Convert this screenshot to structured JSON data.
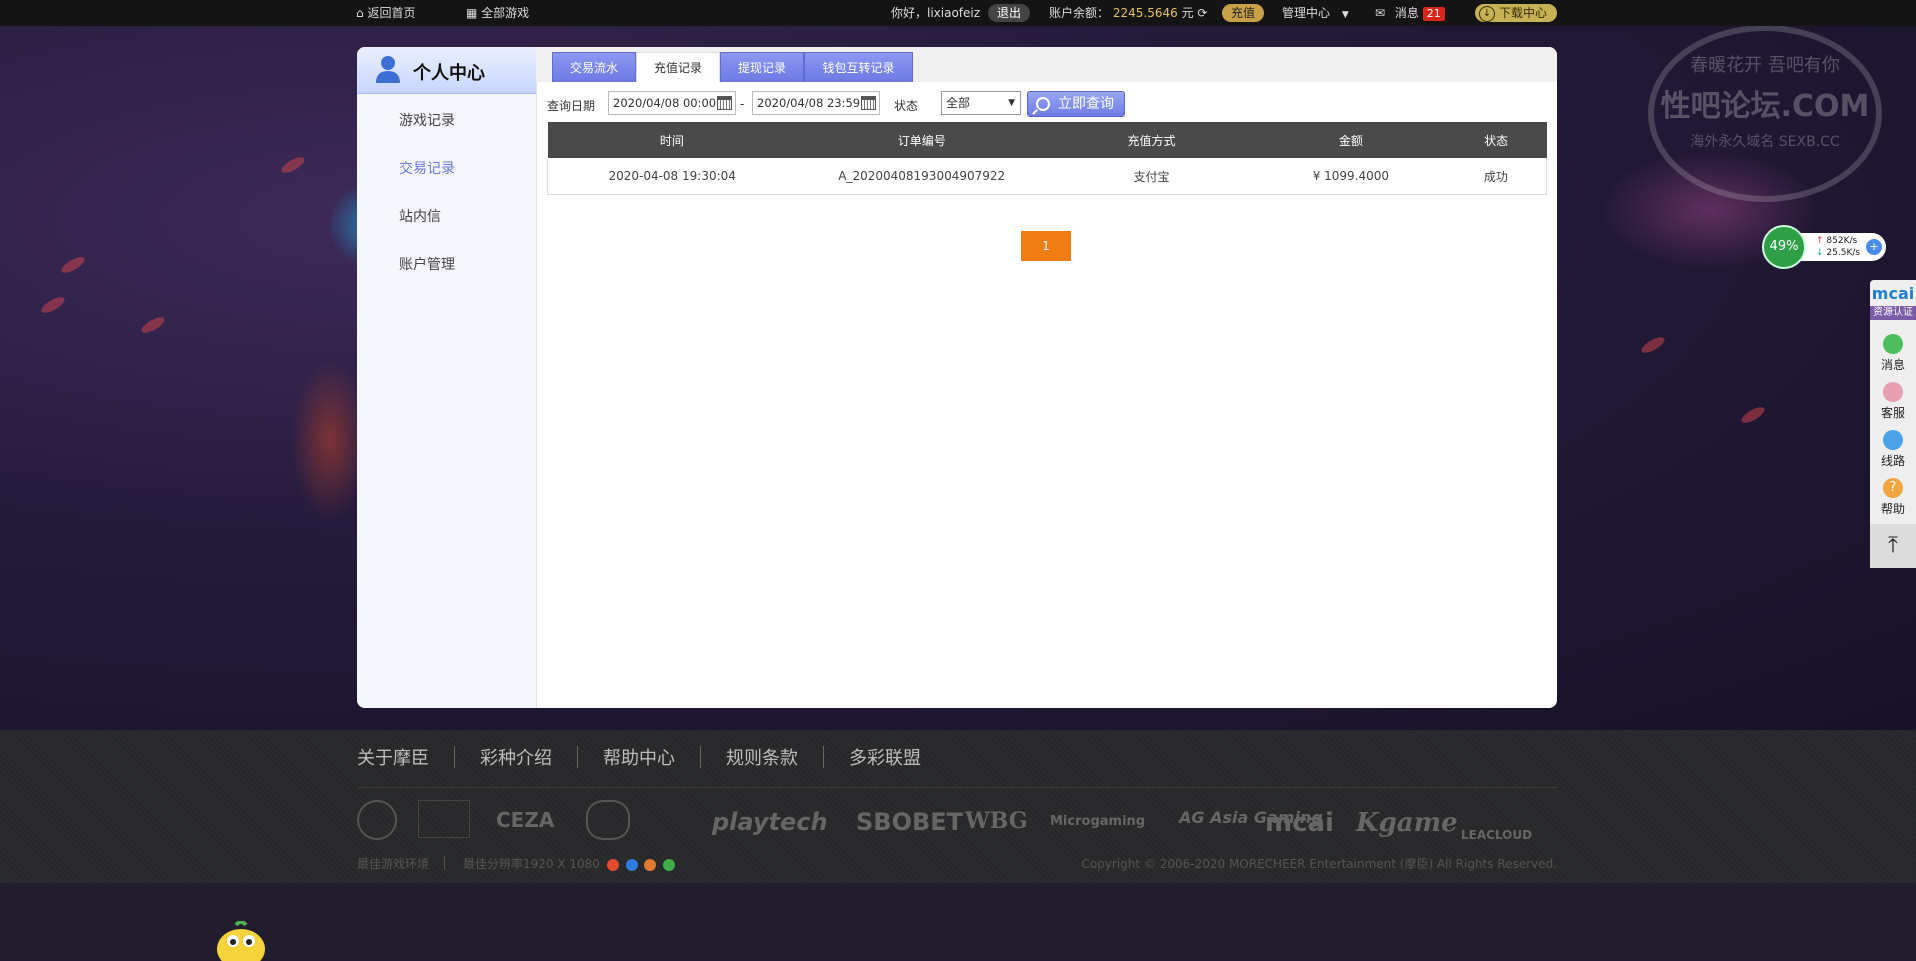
{
  "topbar": {
    "home": "返回首页",
    "all_games": "全部游戏",
    "greeting": "你好，lixiaofeiz",
    "logout": "退出",
    "balance_label": "账户余额：",
    "balance_value": "2245.5646",
    "balance_unit": "元",
    "recharge": "充值",
    "manage": "管理中心",
    "messages": "消息",
    "messages_count": "21",
    "download": "下载中心"
  },
  "sidebar": {
    "title": "个人中心",
    "items": [
      {
        "label": "游戏记录"
      },
      {
        "label": "交易记录"
      },
      {
        "label": "站内信"
      },
      {
        "label": "账户管理"
      }
    ]
  },
  "tabs": [
    {
      "label": "交易流水"
    },
    {
      "label": "充值记录"
    },
    {
      "label": "提现记录"
    },
    {
      "label": "钱包互转记录"
    }
  ],
  "query": {
    "date_label": "查询日期",
    "start": "2020/04/08 00:00",
    "dash": "-",
    "end": "2020/04/08 23:59",
    "status_label": "状态",
    "status_value": "全部",
    "button": "立即查询"
  },
  "table": {
    "headers": [
      "时间",
      "订单编号",
      "充值方式",
      "金额",
      "状态"
    ],
    "rows": [
      [
        "2020-04-08 19:30:04",
        "A_20200408193004907922",
        "支付宝",
        "¥ 1099.4000",
        "成功"
      ]
    ]
  },
  "pagination": {
    "current": "1"
  },
  "footer": {
    "links": [
      "关于摩臣",
      "彩种介绍",
      "帮助中心",
      "规则条款",
      "多彩联盟"
    ],
    "logos": [
      "CEZA",
      "playtech",
      "SBOBET",
      "WBG",
      "Microgaming",
      "AG Asia Gaming",
      "mcai",
      "Kgame",
      "LEACLOUD"
    ],
    "env": "最佳游戏环境",
    "resolution": "最佳分辨率1920 X 1080",
    "copyright": "Copyright © 2006-2020 MORECHEER Entertainment (摩臣) All Rights Reserved."
  },
  "right_tools": {
    "brand": "mcai",
    "brand_sub": "资源认证",
    "items": [
      {
        "label": "消息",
        "color": "#4cbf5c"
      },
      {
        "label": "客服",
        "color": "#e8a0b0"
      },
      {
        "label": "线路",
        "color": "#4aa3e8"
      },
      {
        "label": "帮助",
        "color": "#f0a640"
      }
    ]
  },
  "speed_widget": {
    "percent": "49%",
    "up": "852K/s",
    "down": "25.5K/s"
  },
  "watermark": {
    "line1": "春暖花开 吾吧有你",
    "line2": "性吧论坛.COM",
    "line3": "海外永久域名 SEXB.CC"
  }
}
